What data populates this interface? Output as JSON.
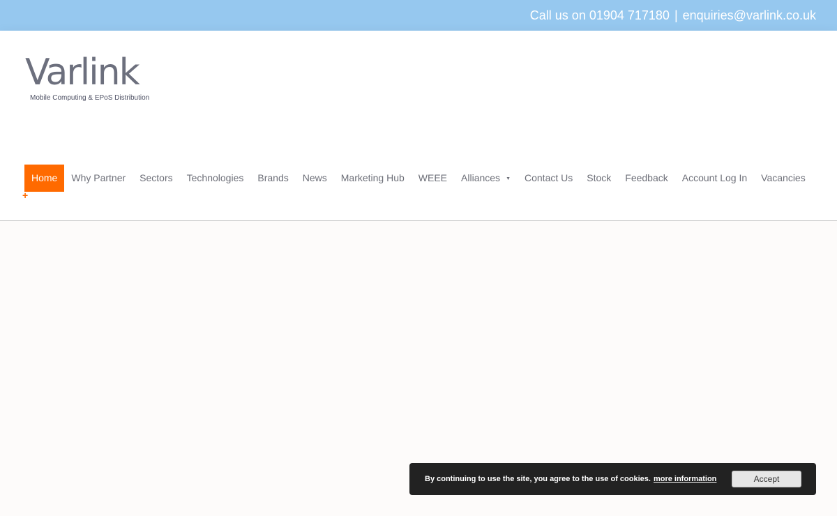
{
  "topbar": {
    "phone_text": "Call us on 01904 717180",
    "separator": "|",
    "email": "enquiries@varlink.co.uk"
  },
  "logo": {
    "wordmark": "Varlink",
    "tagline": "Mobile Computing & EPoS Distribution"
  },
  "nav": {
    "items": [
      {
        "label": "Home"
      },
      {
        "label": "Why Partner"
      },
      {
        "label": "Sectors"
      },
      {
        "label": "Technologies"
      },
      {
        "label": "Brands"
      },
      {
        "label": "News"
      },
      {
        "label": "Marketing Hub"
      },
      {
        "label": "WEEE"
      },
      {
        "label": "Alliances"
      },
      {
        "label": "Contact Us"
      },
      {
        "label": "Stock"
      },
      {
        "label": "Feedback"
      },
      {
        "label": "Account Log In"
      },
      {
        "label": "Vacancies"
      }
    ],
    "active": "Home",
    "dropdown_icon": "▼",
    "plus_icon": "+"
  },
  "cookie": {
    "text": "By continuing to use the site, you agree to the use of cookies.",
    "link_text": "more information",
    "accept_label": "Accept"
  },
  "colors": {
    "topbar_bg": "#96c8ef",
    "accent": "#ff6a00",
    "nav_text": "#6d6f78",
    "cookie_bg": "#222222"
  }
}
